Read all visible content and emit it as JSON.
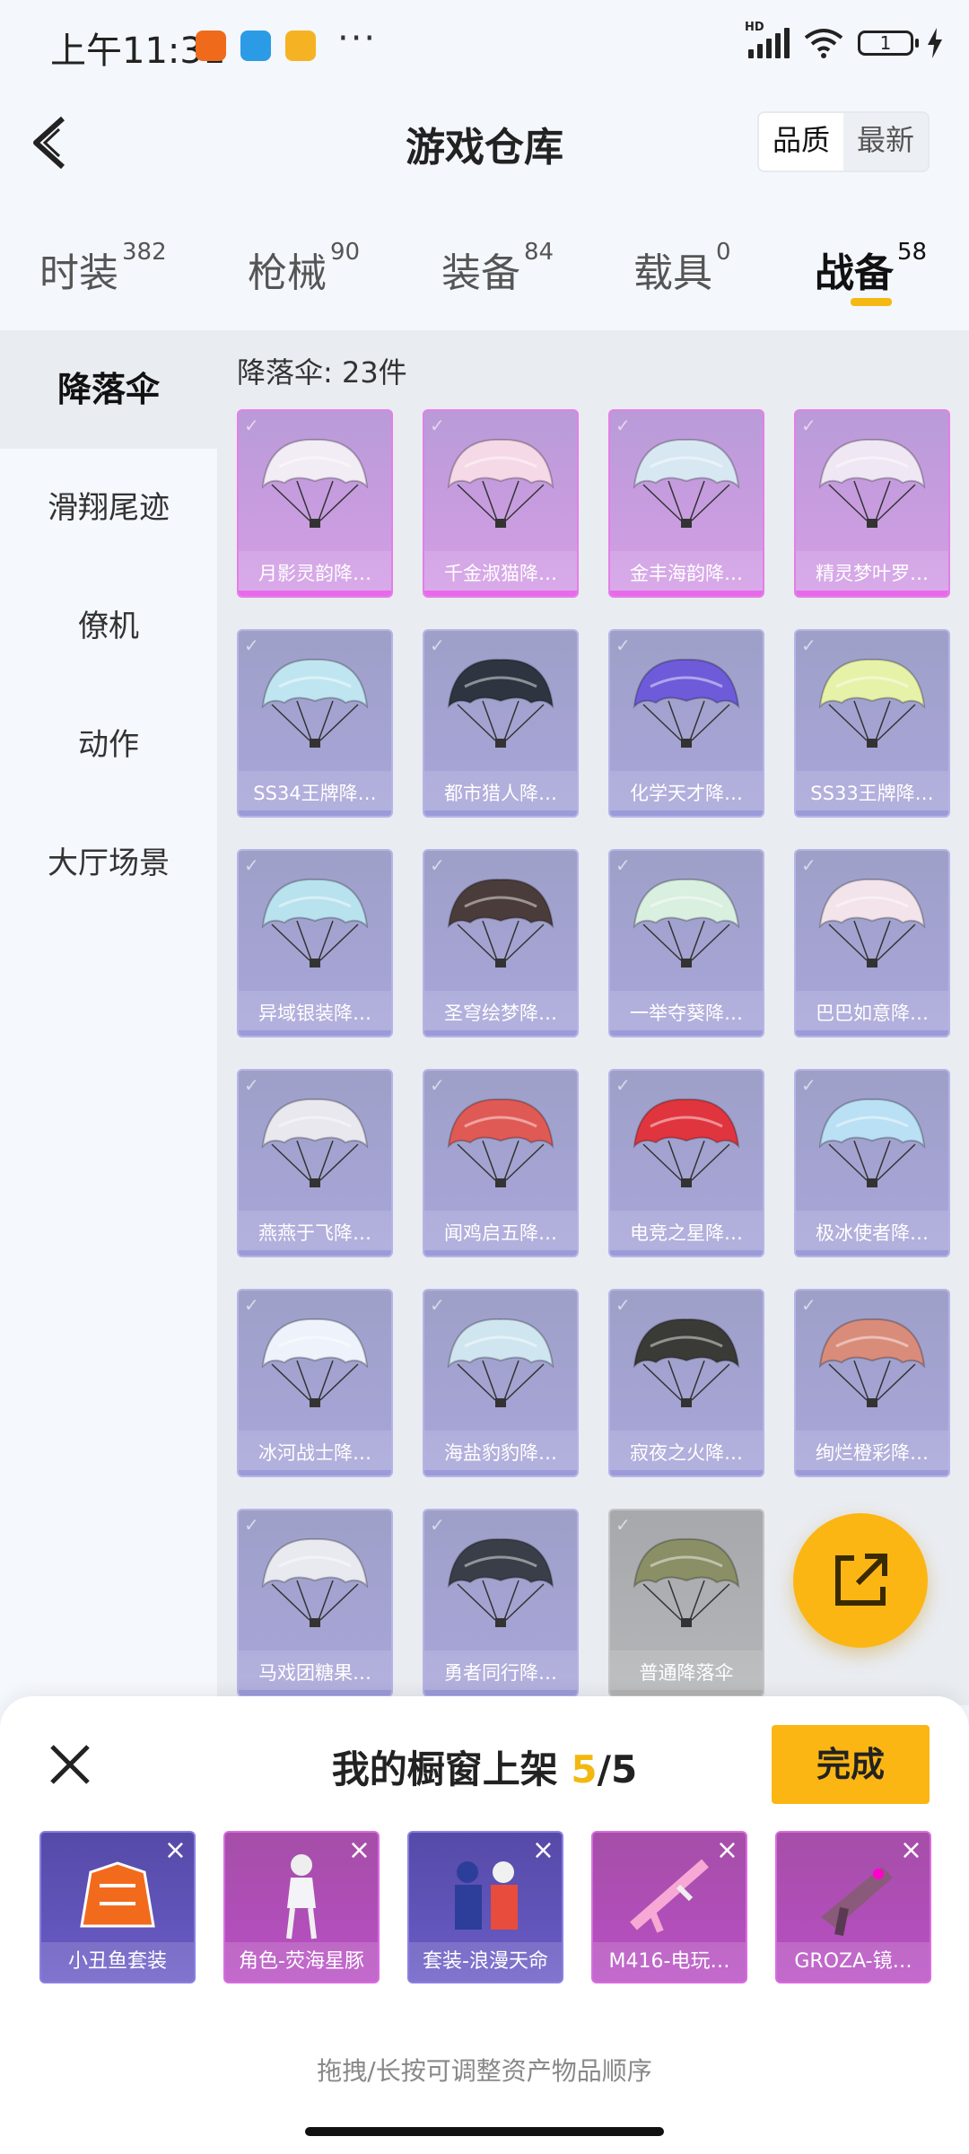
{
  "status_bar": {
    "time": "上午11:31",
    "battery": "1"
  },
  "header": {
    "title": "游戏仓库",
    "sort_options": [
      "品质",
      "最新"
    ],
    "active_sort": "品质"
  },
  "tabs": [
    {
      "label": "时装",
      "count": "382"
    },
    {
      "label": "枪械",
      "count": "90"
    },
    {
      "label": "装备",
      "count": "84"
    },
    {
      "label": "载具",
      "count": "0"
    },
    {
      "label": "战备",
      "count": "58",
      "active": true
    }
  ],
  "sidebar": [
    "降落伞",
    "滑翔尾迹",
    "僚机",
    "动作",
    "大厅场景"
  ],
  "section_title": "降落伞: 23件",
  "items": [
    {
      "name": "月影灵韵降…",
      "rarity": "purple",
      "color": "#f2ecf5"
    },
    {
      "name": "千金淑猫降…",
      "rarity": "purple",
      "color": "#f6d9e6"
    },
    {
      "name": "金丰海韵降…",
      "rarity": "purple",
      "color": "#d8e8f2"
    },
    {
      "name": "精灵梦叶罗…",
      "rarity": "purple",
      "color": "#efe8f4"
    },
    {
      "name": "SS34王牌降…",
      "rarity": "blue",
      "color": "#bfe6f0"
    },
    {
      "name": "都市猎人降…",
      "rarity": "blue",
      "color": "#2e3440"
    },
    {
      "name": "化学天才降…",
      "rarity": "blue",
      "color": "#6d5bd9"
    },
    {
      "name": "SS33王牌降…",
      "rarity": "blue",
      "color": "#e6f2a8"
    },
    {
      "name": "异域银装降…",
      "rarity": "blue",
      "color": "#b8e2ee"
    },
    {
      "name": "圣穹绘梦降…",
      "rarity": "blue",
      "color": "#4a3c3a"
    },
    {
      "name": "一举夺葵降…",
      "rarity": "blue",
      "color": "#d9efe0"
    },
    {
      "name": "巴巴如意降…",
      "rarity": "blue",
      "color": "#f2e4ea"
    },
    {
      "name": "燕燕于飞降…",
      "rarity": "blue",
      "color": "#e8e8ee"
    },
    {
      "name": "闻鸡启五降…",
      "rarity": "blue",
      "color": "#e05a55"
    },
    {
      "name": "电竞之星降…",
      "rarity": "blue",
      "color": "#e0353e"
    },
    {
      "name": "极冰使者降…",
      "rarity": "blue",
      "color": "#b9e0f4"
    },
    {
      "name": "冰河战士降…",
      "rarity": "blue",
      "color": "#eef2fa"
    },
    {
      "name": "海盐豹豹降…",
      "rarity": "blue",
      "color": "#cfe6f0"
    },
    {
      "name": "寂夜之火降…",
      "rarity": "blue",
      "color": "#3a3a36"
    },
    {
      "name": "绚烂橙彩降…",
      "rarity": "blue",
      "color": "#d98c7a"
    },
    {
      "name": "马戏团糖果…",
      "rarity": "blue",
      "color": "#e8eaf0"
    },
    {
      "name": "勇者同行降…",
      "rarity": "blue",
      "color": "#3a3e48"
    },
    {
      "name": "普通降落伞",
      "rarity": "gray",
      "color": "#8a8f66"
    }
  ],
  "showcase": {
    "title_prefix": "我的橱窗上架",
    "current": "5",
    "total": "/5",
    "done_label": "完成",
    "hint": "拖拽/长按可调整资产物品顺序",
    "items": [
      {
        "name": "小丑鱼套装",
        "rarity": "blue"
      },
      {
        "name": "角色-荧海星豚",
        "rarity": "purple"
      },
      {
        "name": "套装-浪漫天命",
        "rarity": "blue"
      },
      {
        "name": "M416-电玩…",
        "rarity": "purple"
      },
      {
        "name": "GROZA-镜…",
        "rarity": "purple"
      }
    ]
  }
}
